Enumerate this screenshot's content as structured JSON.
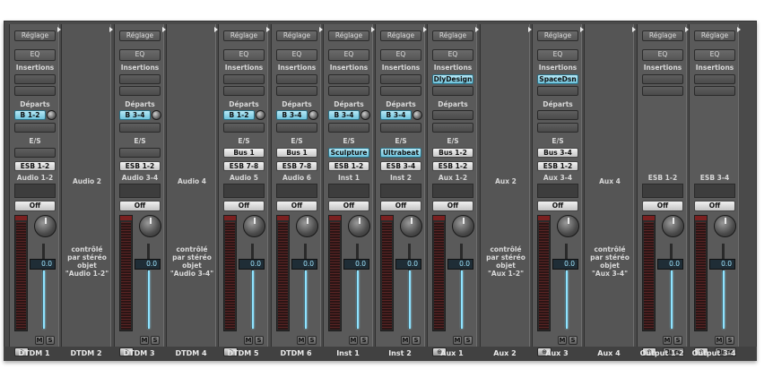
{
  "labels": {
    "setting": "Réglage",
    "eq": "EQ",
    "inserts": "Insertions",
    "sends": "Départs",
    "io": "E/S",
    "automation": "Off",
    "mute": "M",
    "solo": "S"
  },
  "strips": [
    {
      "kind": "channel",
      "name": "Audio 1-2",
      "bottom": "DTDM 1",
      "inserts": [],
      "sends": [
        "B 1-2"
      ],
      "input": "",
      "output": "ESB 1-2",
      "fader": "0.0",
      "mode": "⊕",
      "extra": ""
    },
    {
      "kind": "controlled",
      "name": "Audio 2",
      "bottom": "DTDM 2",
      "note": "contrôlé\npar stéréo\nobjet\n\"Audio 1-2\""
    },
    {
      "kind": "channel",
      "name": "Audio 3-4",
      "bottom": "DTDM 3",
      "inserts": [],
      "sends": [
        "B 3-4"
      ],
      "input": "",
      "output": "ESB 1-2",
      "fader": "0.0",
      "mode": "⊕",
      "extra": ""
    },
    {
      "kind": "controlled",
      "name": "Audio 4",
      "bottom": "DTDM 4",
      "note": "contrôlé\npar stéréo\nobjet\n\"Audio 3-4\""
    },
    {
      "kind": "channel",
      "name": "Audio 5",
      "bottom": "DTDM 5",
      "inserts": [],
      "sends": [
        "B 1-2"
      ],
      "input": "Bus 1",
      "output": "ESB 7-8",
      "fader": "0.0",
      "mode": "○",
      "extra": ""
    },
    {
      "kind": "channel",
      "name": "Audio 6",
      "bottom": "DTDM 6",
      "inserts": [],
      "sends": [
        "B 3-4"
      ],
      "input": "Bus 1",
      "output": "ESB 7-8",
      "fader": "0.0",
      "mode": "",
      "extra": ""
    },
    {
      "kind": "channel",
      "name": "Inst 1",
      "bottom": "Inst 1",
      "inserts": [],
      "sends": [
        "B 3-4"
      ],
      "input": "Sculpture",
      "inputPlug": true,
      "output": "ESB 1-2",
      "fader": "0.0",
      "mode": "",
      "extra": ""
    },
    {
      "kind": "channel",
      "name": "Inst 2",
      "bottom": "Inst 2",
      "inserts": [],
      "sends": [
        "B 3-4"
      ],
      "input": "Ultrabeat",
      "inputPlug": true,
      "output": "ESB 3-4",
      "fader": "0.0",
      "mode": "",
      "extra": ""
    },
    {
      "kind": "channel",
      "name": "Aux 1-2",
      "bottom": "Aux 1",
      "inserts": [
        "DlyDesign"
      ],
      "sends": [],
      "input": "Bus 1-2",
      "output": "ESB 1-2",
      "fader": "0.0",
      "mode": "⊕",
      "extra": ""
    },
    {
      "kind": "controlled",
      "name": "Aux 2",
      "bottom": "Aux 2",
      "note": "contrôlé\npar stéréo\nobjet\n\"Aux 1-2\""
    },
    {
      "kind": "channel",
      "name": "Aux 3-4",
      "bottom": "Aux 3",
      "inserts": [
        "SpaceDsn"
      ],
      "sends": [],
      "input": "Bus 3-4",
      "output": "ESB 1-2",
      "fader": "0.0",
      "mode": "⊕",
      "extra": ""
    },
    {
      "kind": "controlled",
      "name": "Aux 4",
      "bottom": "Aux 4",
      "note": "contrôlé\npar stéréo\nobjet\n\"Aux 3-4\""
    },
    {
      "kind": "output",
      "name": "ESB 1-2",
      "bottom": "Output 1-2",
      "fader": "0.0",
      "mode": "⊕",
      "extra": "Bnce"
    },
    {
      "kind": "output",
      "name": "ESB 3-4",
      "bottom": "Output 3-4",
      "fader": "0.0",
      "mode": "⊕",
      "extra": "Bnce"
    }
  ]
}
